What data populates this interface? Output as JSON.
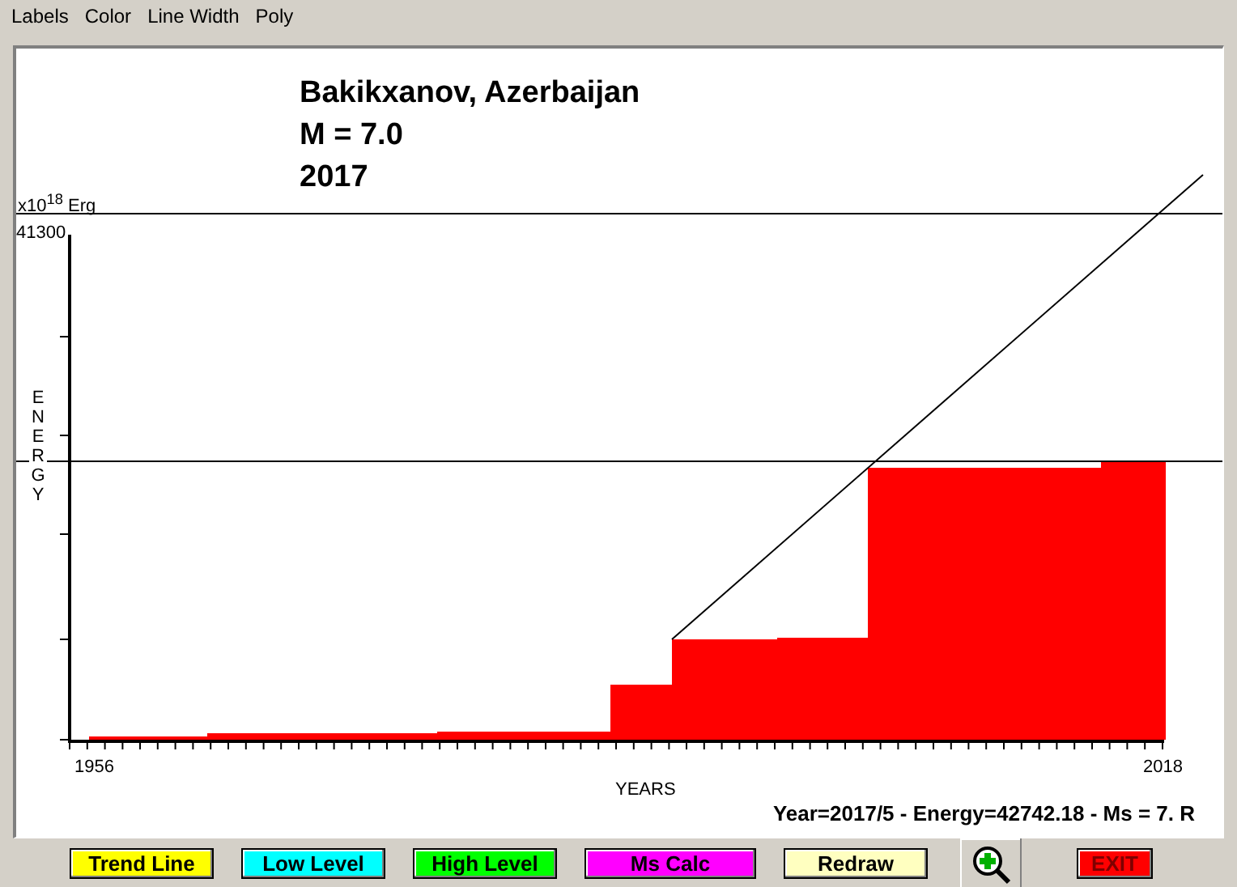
{
  "menu": [
    "Labels",
    "Color",
    "Line Width",
    "Poly"
  ],
  "chart": {
    "title_lines": [
      "Bakikxanov, Azerbaijan",
      "M = 7.0",
      "2017"
    ],
    "y_unit": "x10$^{18}$ Erg",
    "y_max": "41300",
    "y_label": "ENERGY",
    "x_start": "1956",
    "x_end": "2018",
    "x_label": "YEARS",
    "status": "Year=2017/5 - Energy=42742.18 - Ms = 7. R"
  },
  "buttons": [
    {
      "kind": "text",
      "label": "Trend Line",
      "color": "#ffff00"
    },
    {
      "kind": "text",
      "label": "Low Level",
      "color": "#00ffff"
    },
    {
      "kind": "text",
      "label": "High Level",
      "color": "#00ff00"
    },
    {
      "kind": "text",
      "label": "Ms Calc",
      "color": "#ff00ff"
    },
    {
      "kind": "text",
      "label": "Redraw",
      "color": "#ffffc0"
    },
    {
      "kind": "zoom"
    },
    {
      "kind": "text",
      "label": "EXIT",
      "color": "#ff0000"
    }
  ]
}
